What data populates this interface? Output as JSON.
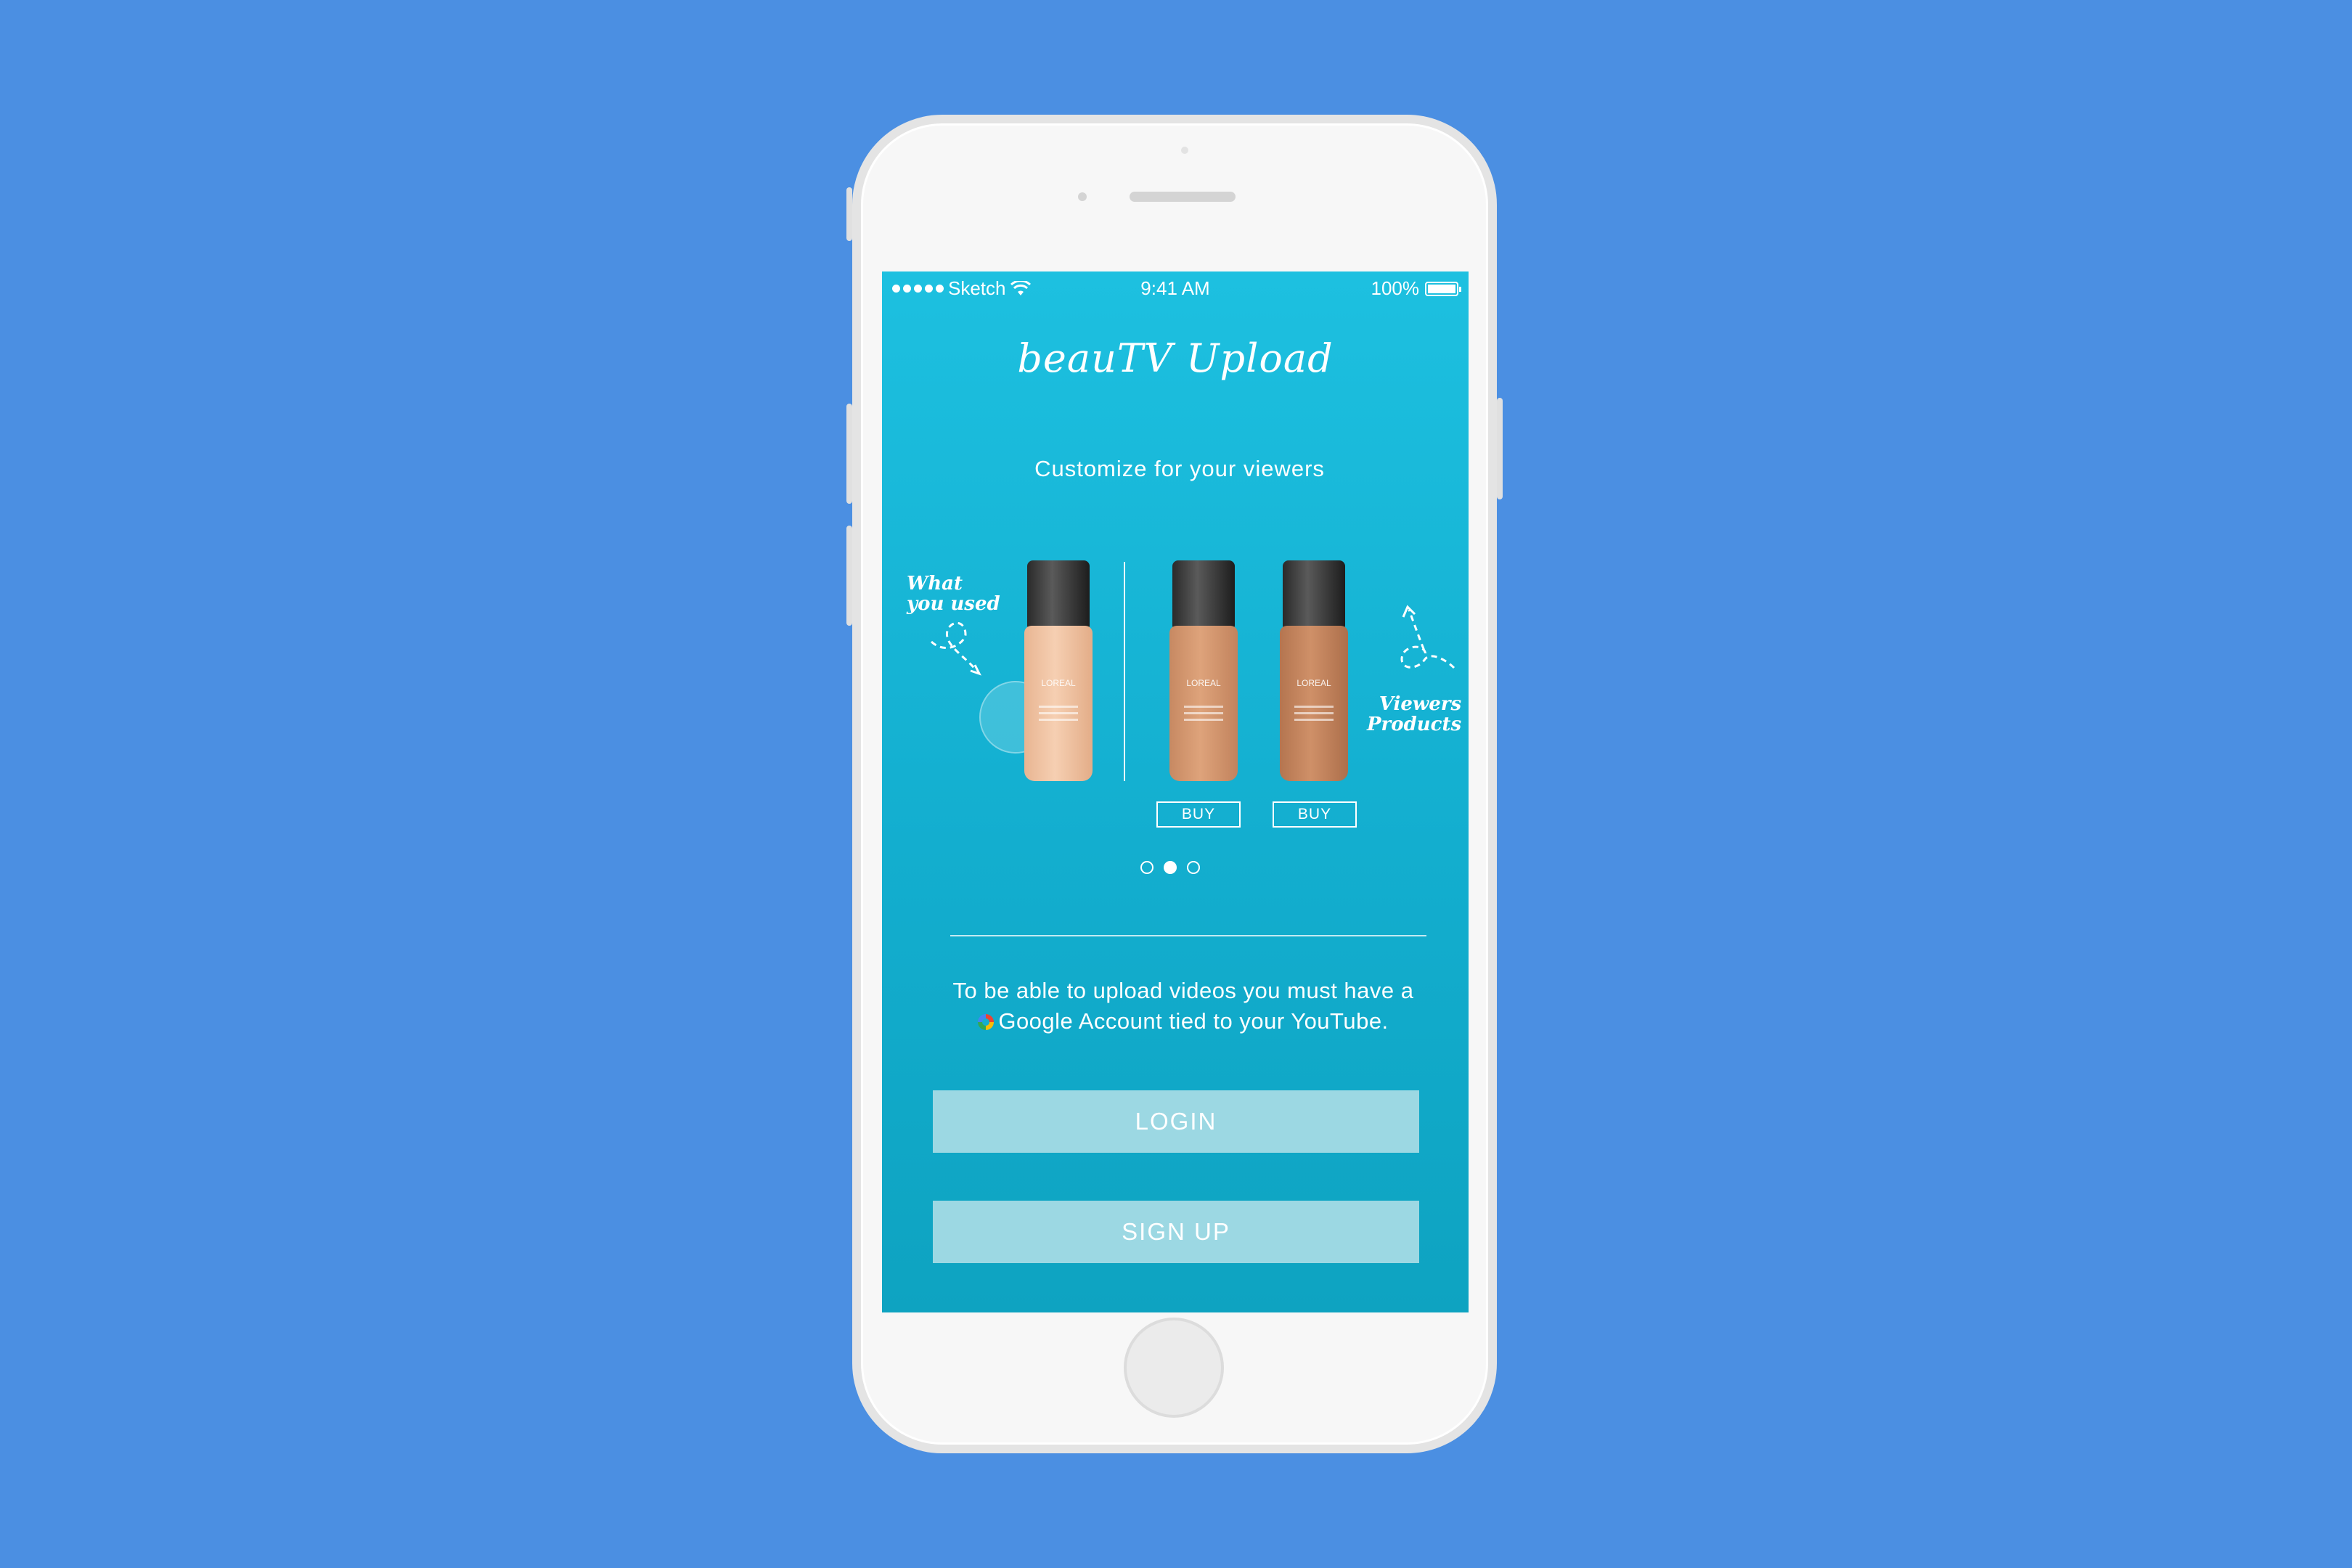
{
  "status_bar": {
    "carrier": "Sketch",
    "time": "9:41 AM",
    "battery": "100%"
  },
  "app": {
    "title": "beauTV Upload",
    "subtitle": "Customize for your viewers"
  },
  "carousel": {
    "annotation_left": [
      "What",
      "you used"
    ],
    "annotation_right": [
      "Viewers",
      "Products"
    ],
    "bottle_brand": "LOREAL",
    "buy_label": "BUY",
    "page_count": 3,
    "active_page": 2,
    "bottle_colors": [
      "#f2c4a3",
      "#d89a72",
      "#c3865c"
    ]
  },
  "info": {
    "line1": "To be able to upload videos you must have a",
    "line2": "Google Account tied to your YouTube."
  },
  "actions": {
    "login_label": "LOGIN",
    "signup_label": "SIGN UP"
  },
  "colors": {
    "background": "#4b8fe2",
    "screen_top": "#1dc0e0",
    "screen_bottom": "#0ea3c1",
    "button": "#9cd8e3"
  }
}
